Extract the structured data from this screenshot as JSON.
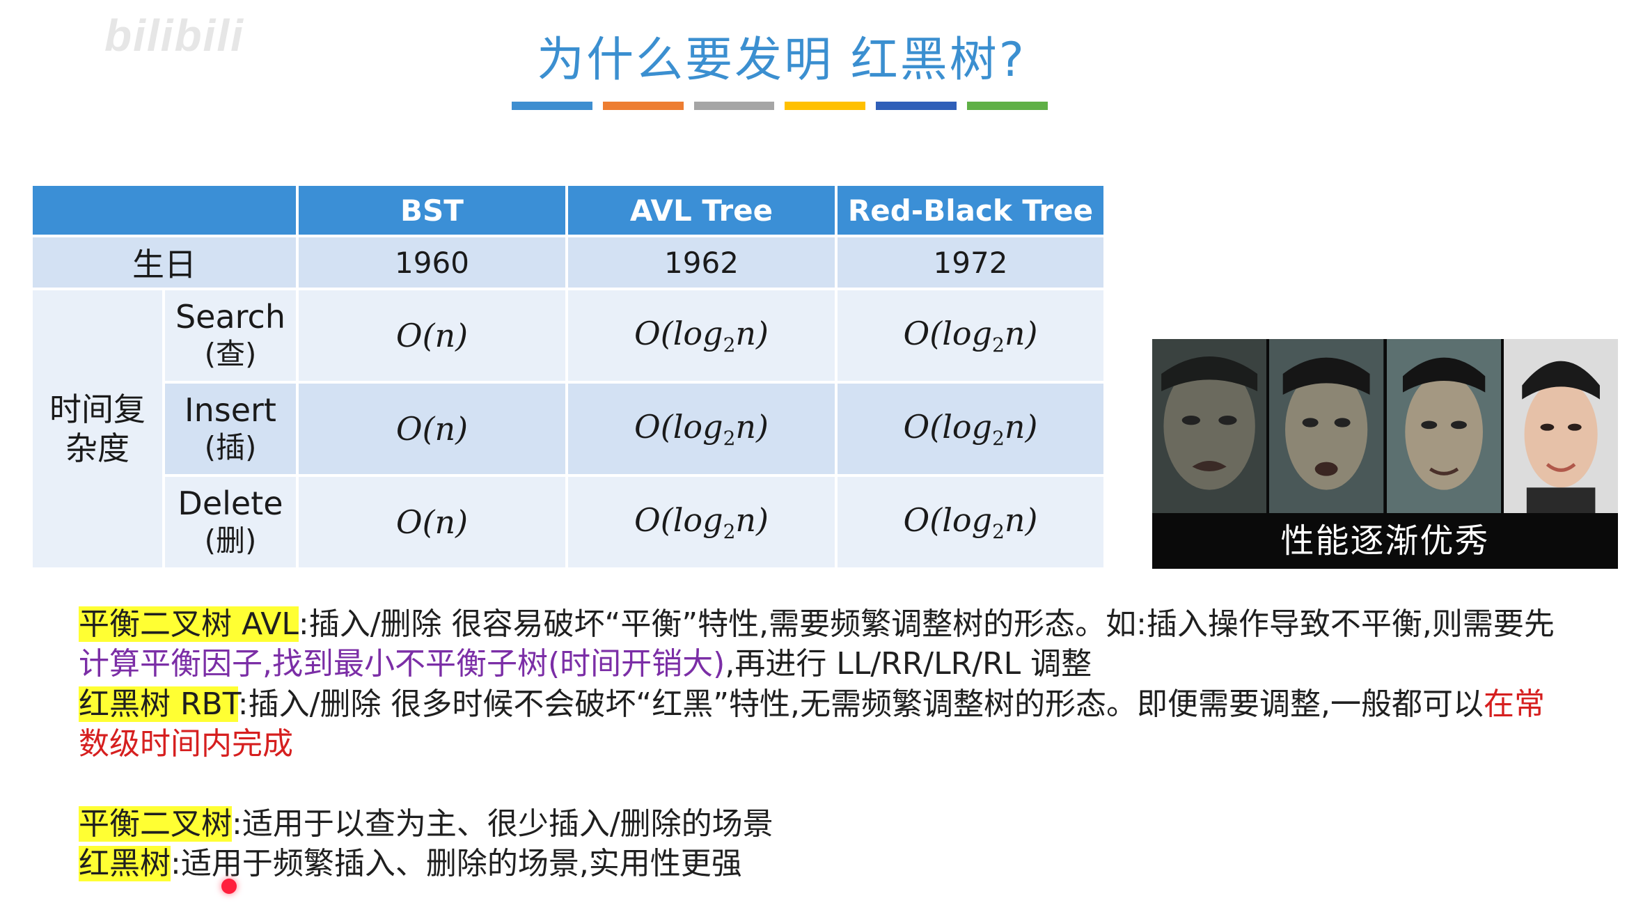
{
  "watermark": "bilibili",
  "title": "为什么要发明 红黑树?",
  "title_bar_colors": [
    "#3e8ed0",
    "#ed7d31",
    "#a5a5a5",
    "#ffc000",
    "#2f5fb8",
    "#5fb046"
  ],
  "table": {
    "headers": [
      "",
      "BST",
      "AVL Tree",
      "Red-Black Tree"
    ],
    "birth_label": "生日",
    "birth": [
      "1960",
      "1962",
      "1972"
    ],
    "complexity_label": "时间复杂度",
    "ops": [
      {
        "en": "Search",
        "zh": "(查)",
        "values": [
          "O(n)",
          "O(log₂n)",
          "O(log₂n)"
        ]
      },
      {
        "en": "Insert",
        "zh": "(插)",
        "values": [
          "O(n)",
          "O(log₂n)",
          "O(log₂n)"
        ]
      },
      {
        "en": "Delete",
        "zh": "(删)",
        "values": [
          "O(n)",
          "O(log₂n)",
          "O(log₂n)"
        ]
      }
    ]
  },
  "image": {
    "caption": "性能逐渐优秀"
  },
  "paragraphs": {
    "avl_label": "平衡二叉树 AVL",
    "avl_text_1": ":插入/删除 很容易破坏“平衡”特性,需要频繁调整树的形态。如:插入操作导致不平衡,则需要先",
    "avl_text_purple": "计算平衡因子,找到最小不平衡子树(时间开销大)",
    "avl_text_2": ",再进行 LL/RR/LR/RL 调整",
    "rbt_label": "红黑树 RBT",
    "rbt_text_1": ":插入/删除 很多时候不会破坏“红黑”特性,无需频繁调整树的形态。即便需要调整,一般都可以",
    "rbt_text_red": "在常数级时间内完成",
    "balance_label": "平衡二叉树",
    "balance_text": ":适用于以查为主、很少插入/删除的场景",
    "redblack_label": "红黑树",
    "redblack_text": ":适用于频繁插入、删除的场景,实用性更强"
  }
}
